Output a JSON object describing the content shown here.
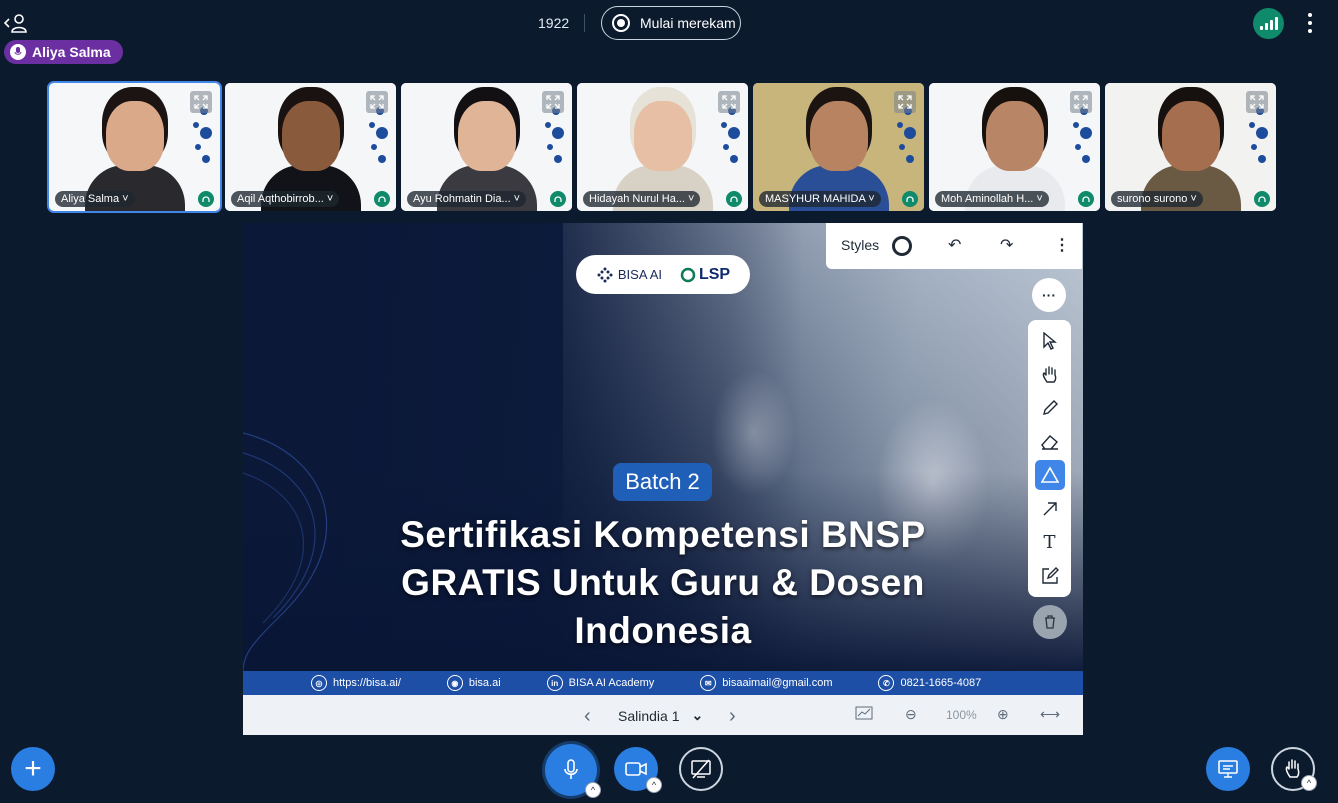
{
  "header": {
    "active_speaker": "Aliya Salma",
    "meeting_id": "1922",
    "record_label": "Mulai merekam"
  },
  "participants": [
    {
      "name": "Aliya Salma",
      "active": true,
      "skin": "#d9a98a",
      "hair": "#1b1412",
      "shirt": "#2a2a2e",
      "bg": "#f6f7f9"
    },
    {
      "name": "Aqil Aqthobirrob...",
      "active": false,
      "skin": "#8a5a3c",
      "hair": "#1a1210",
      "shirt": "#111318",
      "bg": "#f4f6f8"
    },
    {
      "name": "Ayu Rohmatin Dia...",
      "active": false,
      "skin": "#e0b497",
      "hair": "#121012",
      "shirt": "#3a3a40",
      "bg": "#f4f6f8"
    },
    {
      "name": "Hidayah Nurul Ha...",
      "active": false,
      "skin": "#e6bfa4",
      "hair": "#e7e2d8",
      "shirt": "#d8d2c6",
      "bg": "#f4f6f8"
    },
    {
      "name": "MASYHUR MAHIDA",
      "active": false,
      "skin": "#b78360",
      "hair": "#1b1411",
      "shirt": "#2a4f96",
      "bg": "#c8b57c"
    },
    {
      "name": "Moh Aminollah H...",
      "active": false,
      "skin": "#b98567",
      "hair": "#17110e",
      "shirt": "#e8eaee",
      "bg": "#f4f6f8"
    },
    {
      "name": "surono surono",
      "active": false,
      "skin": "#a46e4f",
      "hair": "#16110e",
      "shirt": "#6a5a44",
      "bg": "#f2f2f0"
    }
  ],
  "slide": {
    "logo_left": "BISA AI",
    "logo_right": "LSP",
    "batch": "Batch 2",
    "headline_line1": "Sertifikasi Kompetensi BNSP",
    "headline_line2": "GRATIS Untuk Guru & Dosen",
    "headline_line3": "Indonesia",
    "contacts": [
      {
        "icon": "globe-icon",
        "glyph": "◎",
        "text": "https://bisa.ai/"
      },
      {
        "icon": "instagram-icon",
        "glyph": "◉",
        "text": "bisa.ai"
      },
      {
        "icon": "linkedin-icon",
        "glyph": "in",
        "text": "BISA AI Academy"
      },
      {
        "icon": "mail-icon",
        "glyph": "✉",
        "text": "bisaaimail@gmail.com"
      },
      {
        "icon": "whatsapp-icon",
        "glyph": "✆",
        "text": "0821-1665-4087"
      }
    ]
  },
  "slide_controls": {
    "current_slide": "Salindia 1",
    "zoom": "100%"
  },
  "whiteboard": {
    "styles_label": "Styles",
    "active_tool": "shape"
  },
  "colors": {
    "background": "#0b1a2d",
    "accent": "#2a7de1",
    "speaker": "#6b2fa1",
    "audio": "#0f8a6a"
  }
}
